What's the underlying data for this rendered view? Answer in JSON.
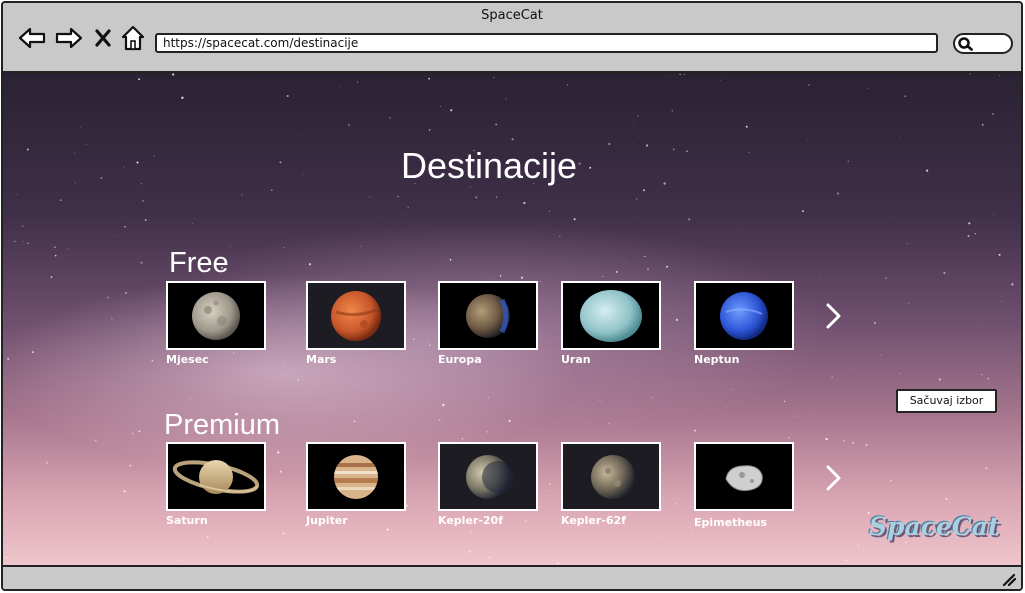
{
  "window": {
    "title": "SpaceCat"
  },
  "toolbar": {
    "url": "https://spacecat.com/destinacije",
    "icons": [
      "back-arrow-icon",
      "forward-arrow-icon",
      "close-x-icon",
      "home-icon",
      "search-icon"
    ]
  },
  "page": {
    "title": "Destinacije",
    "save_button": "Sačuvaj izbor",
    "logo_text": "SpaceCat"
  },
  "sections": {
    "free": {
      "label": "Free",
      "items": [
        {
          "label": "Mjesec"
        },
        {
          "label": "Mars"
        },
        {
          "label": "Europa"
        },
        {
          "label": "Uran"
        },
        {
          "label": "Neptun"
        }
      ]
    },
    "premium": {
      "label": "Premium",
      "items": [
        {
          "label": "Saturn"
        },
        {
          "label": "Jupiter"
        },
        {
          "label": "Kepler-20f"
        },
        {
          "label": "Kepler-62f"
        },
        {
          "label": "Epimetheus"
        }
      ]
    }
  },
  "colors": {
    "frame": "#c9c9c9",
    "border": "#222222",
    "text_light": "#ffffff"
  }
}
